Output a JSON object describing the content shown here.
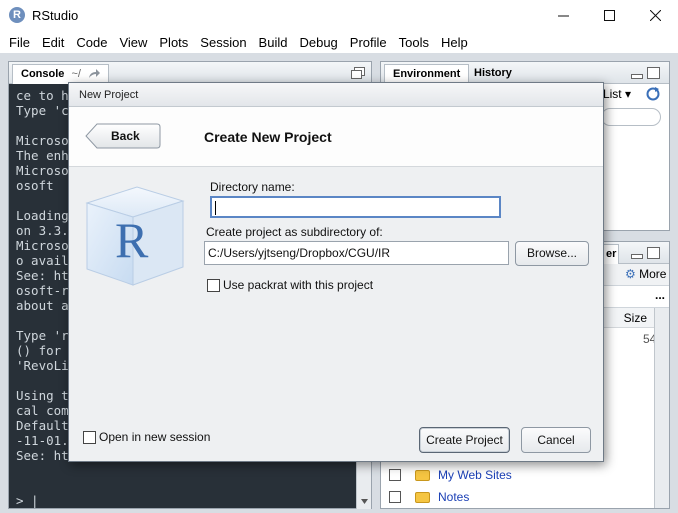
{
  "window": {
    "title": "RStudio"
  },
  "menubar": [
    "File",
    "Edit",
    "Code",
    "View",
    "Plots",
    "Session",
    "Build",
    "Debug",
    "Profile",
    "Tools",
    "Help"
  ],
  "console": {
    "tab_label": "Console",
    "path": "~/",
    "lines": [
      "ce to h",
      "Type 'c",
      "",
      "Microso",
      "The enh",
      "Microso",
      "osoft",
      "",
      "Loading",
      "on 3.3.",
      "Microso",
      "o avail",
      "See: ht",
      "osoft-r",
      "about a",
      "",
      "Type 'r",
      "() for",
      "'RevoLi",
      "",
      "Using t",
      "cal com",
      "Default",
      "-11-01.",
      "See: ht",
      "",
      "",
      "> |"
    ]
  },
  "env_pane": {
    "tabs": [
      "Environment",
      "History"
    ],
    "list_label": "List"
  },
  "files_pane": {
    "tab_fragment": "er",
    "more_label": "More",
    "size_header": "Size",
    "size_value": "54",
    "rows": [
      "My Web Sites",
      "Notes"
    ]
  },
  "dialog": {
    "title": "New Project",
    "back_label": "Back",
    "heading": "Create New Project",
    "directory_label": "Directory name:",
    "directory_value": "",
    "subdir_label": "Create project as subdirectory of:",
    "subdir_value": "C:/Users/yjtseng/Dropbox/CGU/IR",
    "browse_label": "Browse...",
    "packrat_label": "Use packrat with this project",
    "packrat_checked": false,
    "new_session_label": "Open in new session",
    "new_session_checked": false,
    "create_label": "Create Project",
    "cancel_label": "Cancel",
    "logo_text": "R"
  }
}
